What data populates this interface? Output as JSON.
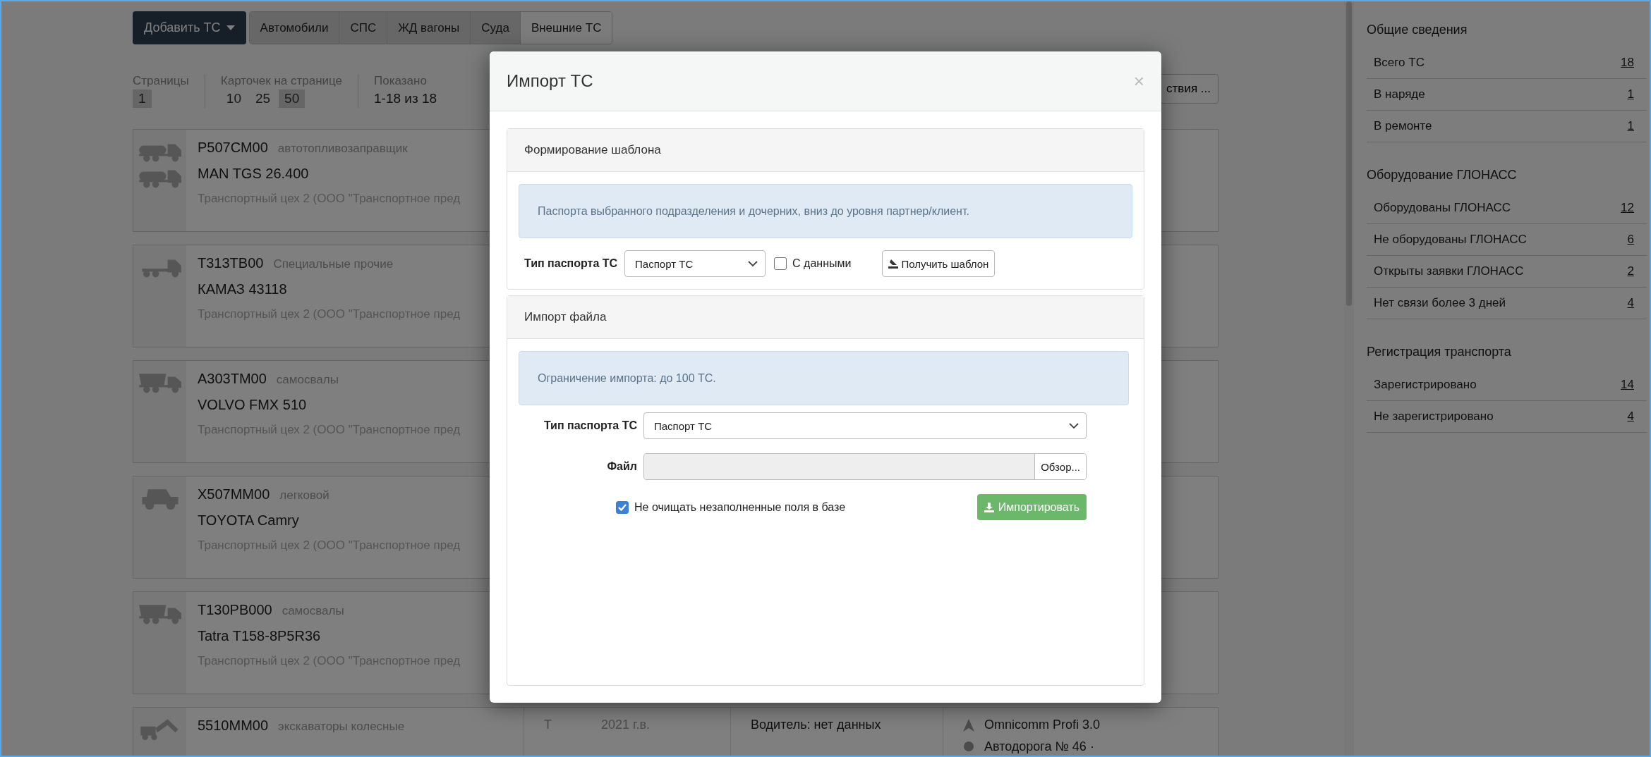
{
  "toolbar": {
    "add_button": "Добавить ТС",
    "filters": [
      {
        "label": "Автомобили",
        "selected": true
      },
      {
        "label": "СПС",
        "selected": true
      },
      {
        "label": "ЖД вагоны",
        "selected": true
      },
      {
        "label": "Суда",
        "selected": true
      },
      {
        "label": "Внешние ТС",
        "selected": false
      }
    ]
  },
  "pagination": {
    "pages_label": "Страницы",
    "pages": [
      {
        "label": "1",
        "selected": true
      }
    ],
    "per_page_label": "Карточек на странице",
    "per_page": [
      {
        "label": "10",
        "selected": false
      },
      {
        "label": "25",
        "selected": false
      },
      {
        "label": "50",
        "selected": true
      }
    ],
    "shown_label": "Показано",
    "shown": "1-18 из 18",
    "actions_button": "ствия ..."
  },
  "cards": [
    {
      "kind": "tanker",
      "plate": "Р507СМ00",
      "type": "автотопливозаправщик",
      "model": "MAN TGS 26.400",
      "org": "Транспортный цех 2 (ООО \"Транспортное пред"
    },
    {
      "kind": "tractor",
      "plate": "Т313ТВ00",
      "type": "Специальные прочие",
      "model": "КАМАЗ 43118",
      "org": "Транспортный цех 2 (ООО \"Транспортное пред"
    },
    {
      "kind": "dump",
      "plate": "А303ТМ00",
      "type": "самосвалы",
      "model": "VOLVO FMX 510",
      "org": "Транспортный цех 2 (ООО \"Транспортное пред"
    },
    {
      "kind": "offroad",
      "plate": "Х507ММ00",
      "type": "легковой",
      "model": "TOYOTA Camry",
      "org": "Транспортный цех 2 (ООО \"Транспортное пред"
    },
    {
      "kind": "dump",
      "plate": "Т130РВ000",
      "type": "самосвалы",
      "model": "Tatra T158-8P5R36",
      "org": "Транспортный цех 2 (ООО \"Транспортное пред"
    }
  ],
  "last_card": {
    "kind": "excavator",
    "plate": "5510ММ00",
    "type": "экскаваторы колесные",
    "column_2": "Т",
    "year": "2021 г.в.",
    "driver": "Водитель: нет данных",
    "device": "Omnicomm Profi 3.0",
    "address": "Автодорога № 46 ·"
  },
  "sidebar": [
    {
      "title": "Общие сведения",
      "items": [
        {
          "label": "Всего ТС",
          "count": "18"
        },
        {
          "label": "В наряде",
          "count": "1"
        },
        {
          "label": "В ремонте",
          "count": "1"
        }
      ]
    },
    {
      "title": "Оборудование ГЛОНАСС",
      "items": [
        {
          "label": "Оборудованы ГЛОНАСС",
          "count": "12"
        },
        {
          "label": "Не оборудованы ГЛОНАСС",
          "count": "6"
        },
        {
          "label": "Открыты заявки ГЛОНАСС",
          "count": "2"
        },
        {
          "label": "Нет связи более 3 дней",
          "count": "4"
        }
      ]
    },
    {
      "title": "Регистрация транспорта",
      "items": [
        {
          "label": "Зарегистрировано",
          "count": "14"
        },
        {
          "label": "Не зарегистрировано",
          "count": "4"
        }
      ]
    }
  ],
  "modal": {
    "title": "Импорт ТС",
    "close": "×",
    "template_panel": {
      "title": "Формирование шаблона",
      "info": "Паспорта выбранного подразделения и дочерних, вниз до уровня партнер/клиент.",
      "type_label": "Тип паспорта ТС",
      "type_value": "Паспорт ТС",
      "with_data": {
        "label": "С данными",
        "checked": false
      },
      "get_button": "Получить шаблон"
    },
    "import_panel": {
      "title": "Импорт файла",
      "info": "Ограничение импорта: до 100 ТС.",
      "type_label": "Тип паспорта ТС",
      "type_value": "Паспорт ТС",
      "file_label": "Файл",
      "browse_button": "Обзор...",
      "keep_fields": {
        "label": "Не очищать незаполненные поля в базе",
        "checked": true
      },
      "import_button": "Импортировать"
    }
  }
}
